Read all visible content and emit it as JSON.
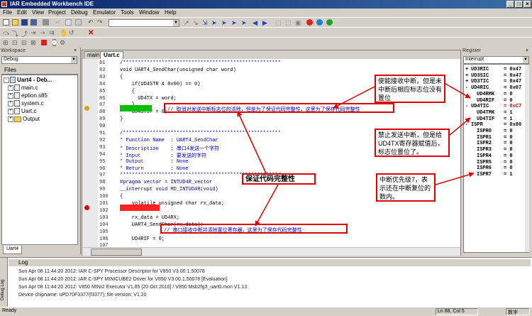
{
  "window": {
    "title": "IAR Embedded Workbench IDE"
  },
  "menu": [
    "File",
    "Edit",
    "View",
    "Project",
    "Debug",
    "Emulator",
    "Tools",
    "Window",
    "Help"
  ],
  "workspace": {
    "title": "Workspace",
    "config": "Debug",
    "files_header": "Files",
    "tree": [
      {
        "label": "Uart4 - Deb...",
        "indent": 0,
        "kind": "project"
      },
      {
        "label": "main.c",
        "indent": 1,
        "kind": "file"
      },
      {
        "label": "eption.s85",
        "indent": 1,
        "kind": "file"
      },
      {
        "label": "system.c",
        "indent": 1,
        "kind": "file"
      },
      {
        "label": "Uart.c",
        "indent": 1,
        "kind": "file"
      },
      {
        "label": "Output",
        "indent": 1,
        "kind": "folder"
      }
    ],
    "bottom_tab": "Uart4"
  },
  "editor": {
    "tabs": [
      "main.c",
      "Uart.c"
    ],
    "lines": [
      {
        "n": "81",
        "text": "/*****************************************************",
        "type": "cmt"
      },
      {
        "n": "82",
        "text": "void UART4_SendChar(unsigned char word)",
        "type": "normal"
      },
      {
        "n": "83",
        "text": "{",
        "type": "normal"
      },
      {
        "n": "84",
        "text": "    if(UD4STR & 0x00) == 0)",
        "type": "normal"
      },
      {
        "n": "85",
        "text": "    {",
        "type": "normal"
      },
      {
        "n": "86",
        "text": "      UD4TX = word;",
        "type": "normal"
      },
      {
        "n": "87",
        "text": "    }",
        "type": "normal"
      },
      {
        "n": "88",
        "text": "    UD4STIF = 0;",
        "type": "normal"
      },
      {
        "n": "89",
        "text": "}",
        "type": "normal"
      },
      {
        "n": "90",
        "text": "",
        "type": "normal"
      },
      {
        "n": "91",
        "text": "/*****************************************************",
        "type": "cmt"
      },
      {
        "n": "92",
        "text": "* Function Name  : UART4_SendChar",
        "type": "cmt"
      },
      {
        "n": "93",
        "text": "* Description    : 串口4发送一个字符",
        "type": "cmt"
      },
      {
        "n": "94",
        "text": "* Input          : 要发送的字符",
        "type": "cmt"
      },
      {
        "n": "95",
        "text": "* Output         : None",
        "type": "cmt"
      },
      {
        "n": "96",
        "text": "* Return         : None",
        "type": "cmt"
      },
      {
        "n": "97",
        "text": "*****************************************************/",
        "type": "cmt"
      },
      {
        "n": "98",
        "text": "#pragma vector = INTUD4R_vector",
        "type": "kw"
      },
      {
        "n": "99",
        "text": "__interrupt void MD_INTUD4R(void)",
        "type": "kw"
      },
      {
        "n": "100",
        "text": "{",
        "type": "normal"
      },
      {
        "n": "101",
        "text": "    volatile unsigned char rx_data;",
        "type": "normal"
      },
      {
        "n": "102",
        "text": "",
        "type": "normal"
      },
      {
        "n": "103",
        "text": "    rx_data = UD4RX;",
        "type": "normal"
      },
      {
        "n": "104",
        "text": "    UART4_SendChar(rx_data);",
        "type": "normal"
      },
      {
        "n": "105",
        "text": "",
        "type": "normal"
      },
      {
        "n": "106",
        "text": "    UD4RIF = 0;",
        "type": "normal"
      },
      {
        "n": "107",
        "text": "",
        "type": "normal"
      },
      {
        "n": "108",
        "text": "}",
        "type": "normal"
      }
    ],
    "comment_88": "// 取消对发送中断标志位的清除，但是为了保证代码完整性，这里为了保存代码完整性",
    "comment_106": "// 串口接收中断并清除置位寄存器，这里为了保存代码完整性"
  },
  "annotations": {
    "center": "保证代码完整性",
    "right_top": "使能接收中断，但是未中断后相应标志位没有置位",
    "right_mid": "禁止发送中断，但是给UD4TX寄存器赋值后，标志位置位了。",
    "right_bottom": "中断优先级7，表示还在中断复位的数内。"
  },
  "register": {
    "title": "Register",
    "selector": "Interrupt",
    "rows": [
      {
        "name": "UD3RIC",
        "val": "= 0x47",
        "exp": "+",
        "red": false
      },
      {
        "name": "UD3SIC",
        "val": "= 0x47",
        "exp": "+",
        "red": false
      },
      {
        "name": "UD3TIC",
        "val": "= 0x47",
        "exp": "+",
        "red": false
      },
      {
        "name": "UD4RIC",
        "val": "= 0x07",
        "exp": "-",
        "red": false
      },
      {
        "name": "UD4RMK",
        "val": "= 0",
        "exp": "",
        "red": false
      },
      {
        "name": "UD4RIF",
        "val": "= 0",
        "exp": "",
        "red": false
      },
      {
        "name": "UD4TIC",
        "val": "= 0xC7",
        "exp": "-",
        "red": true
      },
      {
        "name": "UD4TMK",
        "val": "= 1",
        "exp": "",
        "red": false
      },
      {
        "name": "UD4TIF",
        "val": "= 1",
        "exp": "",
        "red": false
      },
      {
        "name": "ISPR",
        "val": "= 0x80",
        "exp": "-",
        "red": false
      },
      {
        "name": "ISPR0",
        "val": "= 0",
        "exp": "",
        "red": false
      },
      {
        "name": "ISPR1",
        "val": "= 0",
        "exp": "",
        "red": false
      },
      {
        "name": "ISPR2",
        "val": "= 0",
        "exp": "",
        "red": false
      },
      {
        "name": "ISPR3",
        "val": "= 0",
        "exp": "",
        "red": false
      },
      {
        "name": "ISPR4",
        "val": "= 0",
        "exp": "",
        "red": false
      },
      {
        "name": "ISPR5",
        "val": "= 0",
        "exp": "",
        "red": false
      },
      {
        "name": "ISPR6",
        "val": "= 0",
        "exp": "",
        "red": false
      },
      {
        "name": "ISPR7",
        "val": "= 1",
        "exp": "",
        "red": false
      }
    ]
  },
  "log": {
    "title": "Log",
    "side_label": "Debug Log",
    "lines": [
      "Sun Apr 08 11:44:20 2012: IAR C-SPY Processor Descriptor for V850 V3.00.1.50078",
      "Sun Apr 08 11:44:20 2012: IAR C-SPY MINICUBE2 Driver for V850 V3.00.1.50078 [Evaluation]",
      "Sun Apr 08 11:44:20 2012: V850 MINI2 Executor V1.85 [20 Oct 2010] / V850 Msb2fg3_uart0.mon V1.13",
      "Device chipname: uPD70F3377(f3377); file version: V1.20"
    ]
  },
  "status": {
    "left": "Ready",
    "pos": "Ln 88, Col 5",
    "ime": "数字"
  }
}
